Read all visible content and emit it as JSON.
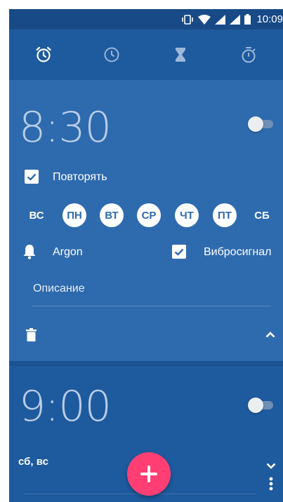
{
  "status_bar": {
    "time": "10:09"
  },
  "tabs": [
    {
      "name": "alarm",
      "icon": "alarm-clock-icon",
      "active": true
    },
    {
      "name": "clock",
      "icon": "clock-icon",
      "active": false
    },
    {
      "name": "timer",
      "icon": "hourglass-icon",
      "active": false
    },
    {
      "name": "stopwatch",
      "icon": "stopwatch-icon",
      "active": false
    }
  ],
  "alarms": [
    {
      "time": "8:30",
      "enabled": false,
      "repeat_label": "Повторять",
      "repeat_checked": true,
      "days": [
        {
          "label": "ВС",
          "on": false
        },
        {
          "label": "ПН",
          "on": true
        },
        {
          "label": "ВТ",
          "on": true
        },
        {
          "label": "СР",
          "on": true
        },
        {
          "label": "ЧТ",
          "on": true
        },
        {
          "label": "ПТ",
          "on": true
        },
        {
          "label": "СБ",
          "on": false
        }
      ],
      "ringtone": "Argon",
      "vibrate_label": "Вибросигнал",
      "vibrate_checked": true,
      "description_placeholder": "Описание"
    },
    {
      "time": "9:00",
      "enabled": false,
      "days_summary": "сб, вс"
    }
  ],
  "colors": {
    "primary": "#1e5a9e",
    "expanded_card": "#2e6aae",
    "accent": "#ff3f73"
  }
}
